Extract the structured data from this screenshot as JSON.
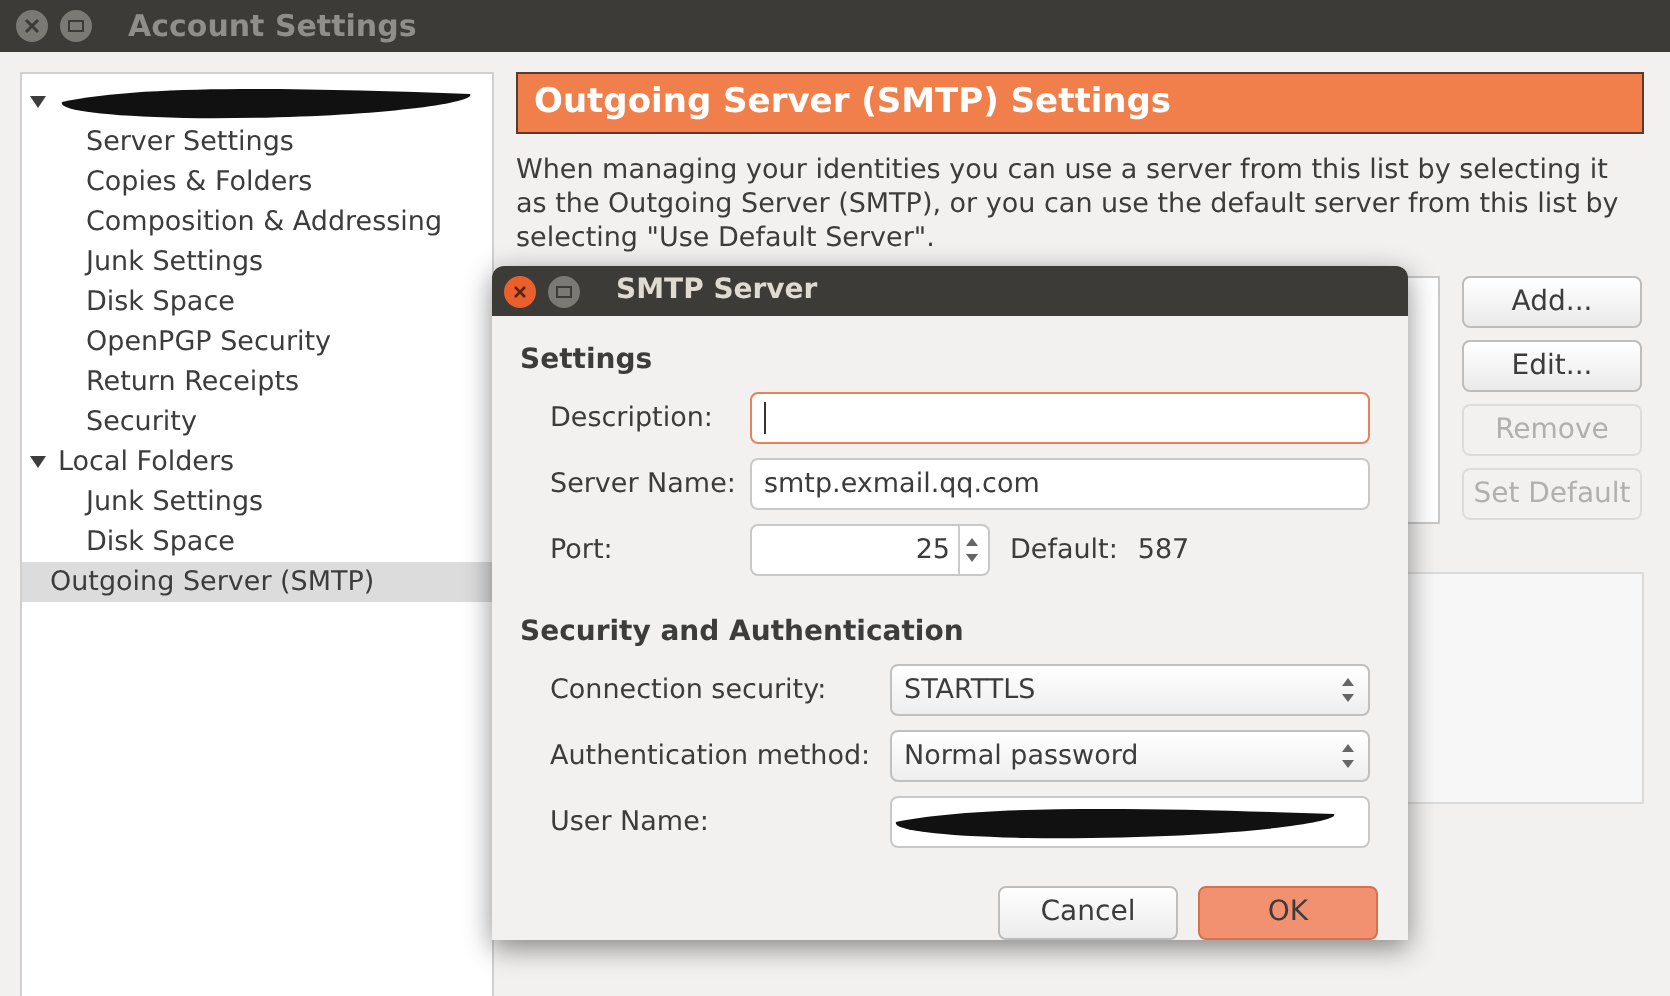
{
  "window": {
    "title": "Account Settings"
  },
  "sidebar": {
    "items": [
      {
        "kind": "account",
        "expanded": true,
        "selected": false,
        "children": [
          {
            "label": "Server Settings",
            "selected": false
          },
          {
            "label": "Copies & Folders",
            "selected": false
          },
          {
            "label": "Composition & Addressing",
            "selected": false
          },
          {
            "label": "Junk Settings",
            "selected": false
          },
          {
            "label": "Disk Space",
            "selected": false
          },
          {
            "label": "OpenPGP Security",
            "selected": false
          },
          {
            "label": "Return Receipts",
            "selected": false
          },
          {
            "label": "Security",
            "selected": false
          }
        ]
      },
      {
        "kind": "folder",
        "label": "Local Folders",
        "expanded": true,
        "selected": false,
        "children": [
          {
            "label": "Junk Settings",
            "selected": false
          },
          {
            "label": "Disk Space",
            "selected": false
          }
        ]
      },
      {
        "kind": "leaf",
        "label": "Outgoing Server (SMTP)",
        "selected": true
      }
    ]
  },
  "panel": {
    "heading": "Outgoing Server (SMTP) Settings",
    "description": "When managing your identities you can use a server from this list by selecting it as the Outgoing Server (SMTP), or you can use the default server from this list by selecting \"Use Default Server\".",
    "buttons": [
      {
        "label": "Add...",
        "disabled": false
      },
      {
        "label": "Edit...",
        "disabled": false
      },
      {
        "label": "Remove",
        "disabled": true
      },
      {
        "label": "Set Default",
        "disabled": true
      }
    ]
  },
  "dialog": {
    "title": "SMTP Server",
    "settings_heading": "Settings",
    "description_label": "Description:",
    "server_name_label": "Server Name:",
    "server_name": "smtp.exmail.qq.com",
    "port_label": "Port:",
    "port": "25",
    "default_label": "Default:",
    "default_port": "587",
    "security_heading": "Security and Authentication",
    "connection_security_label": "Connection security:",
    "connection_security": "STARTTLS",
    "auth_method_label": "Authentication method:",
    "auth_method": "Normal password",
    "user_name_label": "User Name:",
    "buttons": [
      {
        "label": "Cancel",
        "kind": "secondary"
      },
      {
        "label": "OK",
        "kind": "primary"
      }
    ]
  }
}
